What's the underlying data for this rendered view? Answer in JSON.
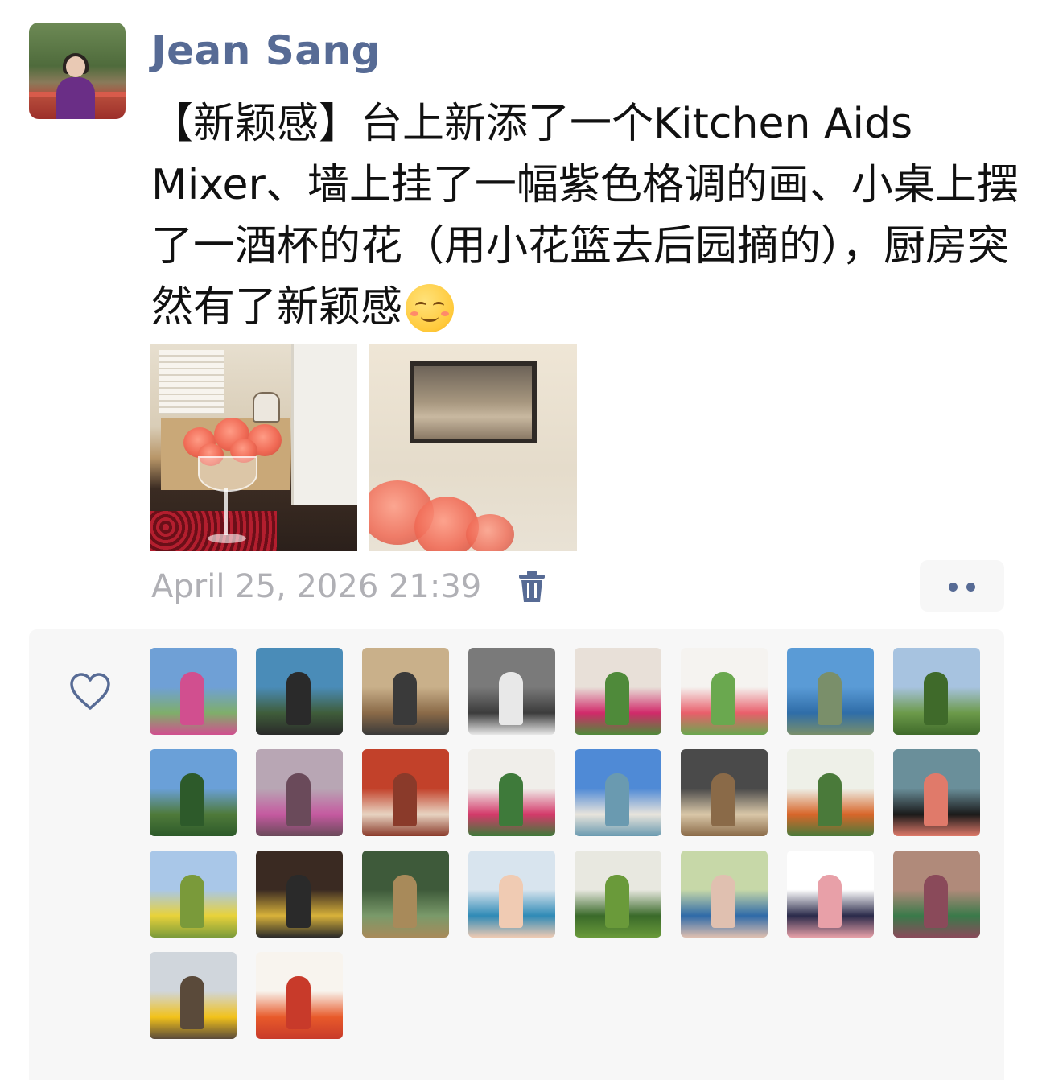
{
  "post": {
    "author": "Jean Sang",
    "text": "【新颖感】台上新添了一个Kitchen Aids Mixer、墙上挂了一幅紫色格调的画、小桌上摆了一酒杯的花（用小花篮去后园摘的），厨房突然有了新颖感",
    "emoji": "smiling-face-icon",
    "photos": [
      "kitchen-flowers-photo",
      "wall-painting-photo"
    ],
    "timestamp": "April 25, 2026 21:39"
  },
  "actions": {
    "delete_icon": "trash-icon",
    "more_icon": "more-dots-icon",
    "like_icon": "heart-icon"
  },
  "likes": {
    "count": 26,
    "avatars": [
      {
        "desc": "lake-house-portrait"
      },
      {
        "desc": "lakeside-woman-portrait"
      },
      {
        "desc": "stone-archway"
      },
      {
        "desc": "ballet-dancer"
      },
      {
        "desc": "pink-hibiscus"
      },
      {
        "desc": "pink-flowers-leaves"
      },
      {
        "desc": "coastal-road"
      },
      {
        "desc": "park-path"
      },
      {
        "desc": "green-field-sky"
      },
      {
        "desc": "magnolia-blossoms"
      },
      {
        "desc": "woman-red-background"
      },
      {
        "desc": "potted-pink-flowers"
      },
      {
        "desc": "beach-sea"
      },
      {
        "desc": "dinner-table"
      },
      {
        "desc": "orange-berries-tree"
      },
      {
        "desc": "black-cat-flowers"
      },
      {
        "desc": "canola-field-woman"
      },
      {
        "desc": "man-with-beer"
      },
      {
        "desc": "garden-planter"
      },
      {
        "desc": "woman-blue-portrait"
      },
      {
        "desc": "houseplant"
      },
      {
        "desc": "woman-blue-hat"
      },
      {
        "desc": "cartoon-woman-glasses"
      },
      {
        "desc": "woman-green-top-blossoms"
      },
      {
        "desc": "woman-yellow-jacket"
      },
      {
        "desc": "cartoon-boy-flag"
      }
    ]
  }
}
